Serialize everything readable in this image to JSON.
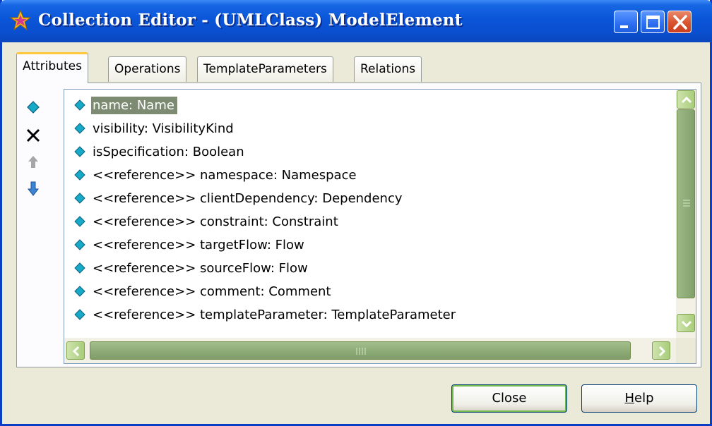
{
  "window": {
    "title": "Collection Editor - (UMLClass) ModelElement"
  },
  "tabs": [
    {
      "label": "Attributes",
      "active": true
    },
    {
      "label": "Operations",
      "active": false
    },
    {
      "label": "TemplateParameters",
      "active": false
    },
    {
      "label": "Relations",
      "active": false
    }
  ],
  "toolbar": {
    "icons": [
      "add-diamond-icon",
      "delete-x-icon",
      "move-up-arrow-icon",
      "move-down-arrow-icon"
    ]
  },
  "attributes": [
    {
      "text": "name: Name",
      "selected": true
    },
    {
      "text": "visibility: VisibilityKind"
    },
    {
      "text": "isSpecification: Boolean"
    },
    {
      "text": "<<reference>> namespace: Namespace"
    },
    {
      "text": "<<reference>> clientDependency: Dependency"
    },
    {
      "text": "<<reference>> constraint: Constraint"
    },
    {
      "text": "<<reference>> targetFlow: Flow"
    },
    {
      "text": "<<reference>> sourceFlow: Flow"
    },
    {
      "text": "<<reference>> comment: Comment"
    },
    {
      "text": "<<reference>> templateParameter: TemplateParameter"
    }
  ],
  "buttons": {
    "close_label": "Close",
    "help_label_underlined": "H",
    "help_label_rest": "elp"
  },
  "colors": {
    "titlebar": "#0a55d8",
    "selection": "#7c8b72",
    "scrollbar_thumb": "#8fae79",
    "diamond": "#16a9c8"
  }
}
